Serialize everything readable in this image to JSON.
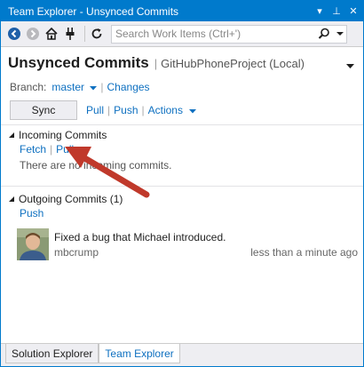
{
  "window": {
    "title": "Team Explorer - Unsynced Commits",
    "dropdown_glyph": "▾",
    "pin_glyph": "⊥",
    "close_glyph": "✕"
  },
  "toolbar": {
    "icons": [
      "back-icon",
      "forward-icon",
      "home-icon",
      "connect-icon",
      "refresh-icon"
    ],
    "search_placeholder": "Search Work Items (Ctrl+')"
  },
  "page": {
    "title": "Unsynced Commits",
    "subtitle": "GitHubPhoneProject (Local)",
    "branch_label": "Branch:",
    "branch_value": "master",
    "changes_link": "Changes",
    "sync_label": "Sync",
    "pull_link": "Pull",
    "push_link": "Push",
    "actions_link": "Actions"
  },
  "incoming": {
    "title": "Incoming Commits",
    "fetch_link": "Fetch",
    "pull_link": "Pull",
    "empty_message": "There are no incoming commits."
  },
  "outgoing": {
    "title": "Outgoing Commits (1)",
    "push_link": "Push",
    "commits": [
      {
        "message": "Fixed a bug that Michael introduced.",
        "author": "mbcrump",
        "time": "less than a minute ago"
      }
    ]
  },
  "tabs": [
    {
      "label": "Solution Explorer",
      "active": false
    },
    {
      "label": "Team Explorer",
      "active": true
    }
  ],
  "colors": {
    "accent": "#007acc",
    "link": "#0e70c0",
    "arrow": "#c0392b"
  }
}
